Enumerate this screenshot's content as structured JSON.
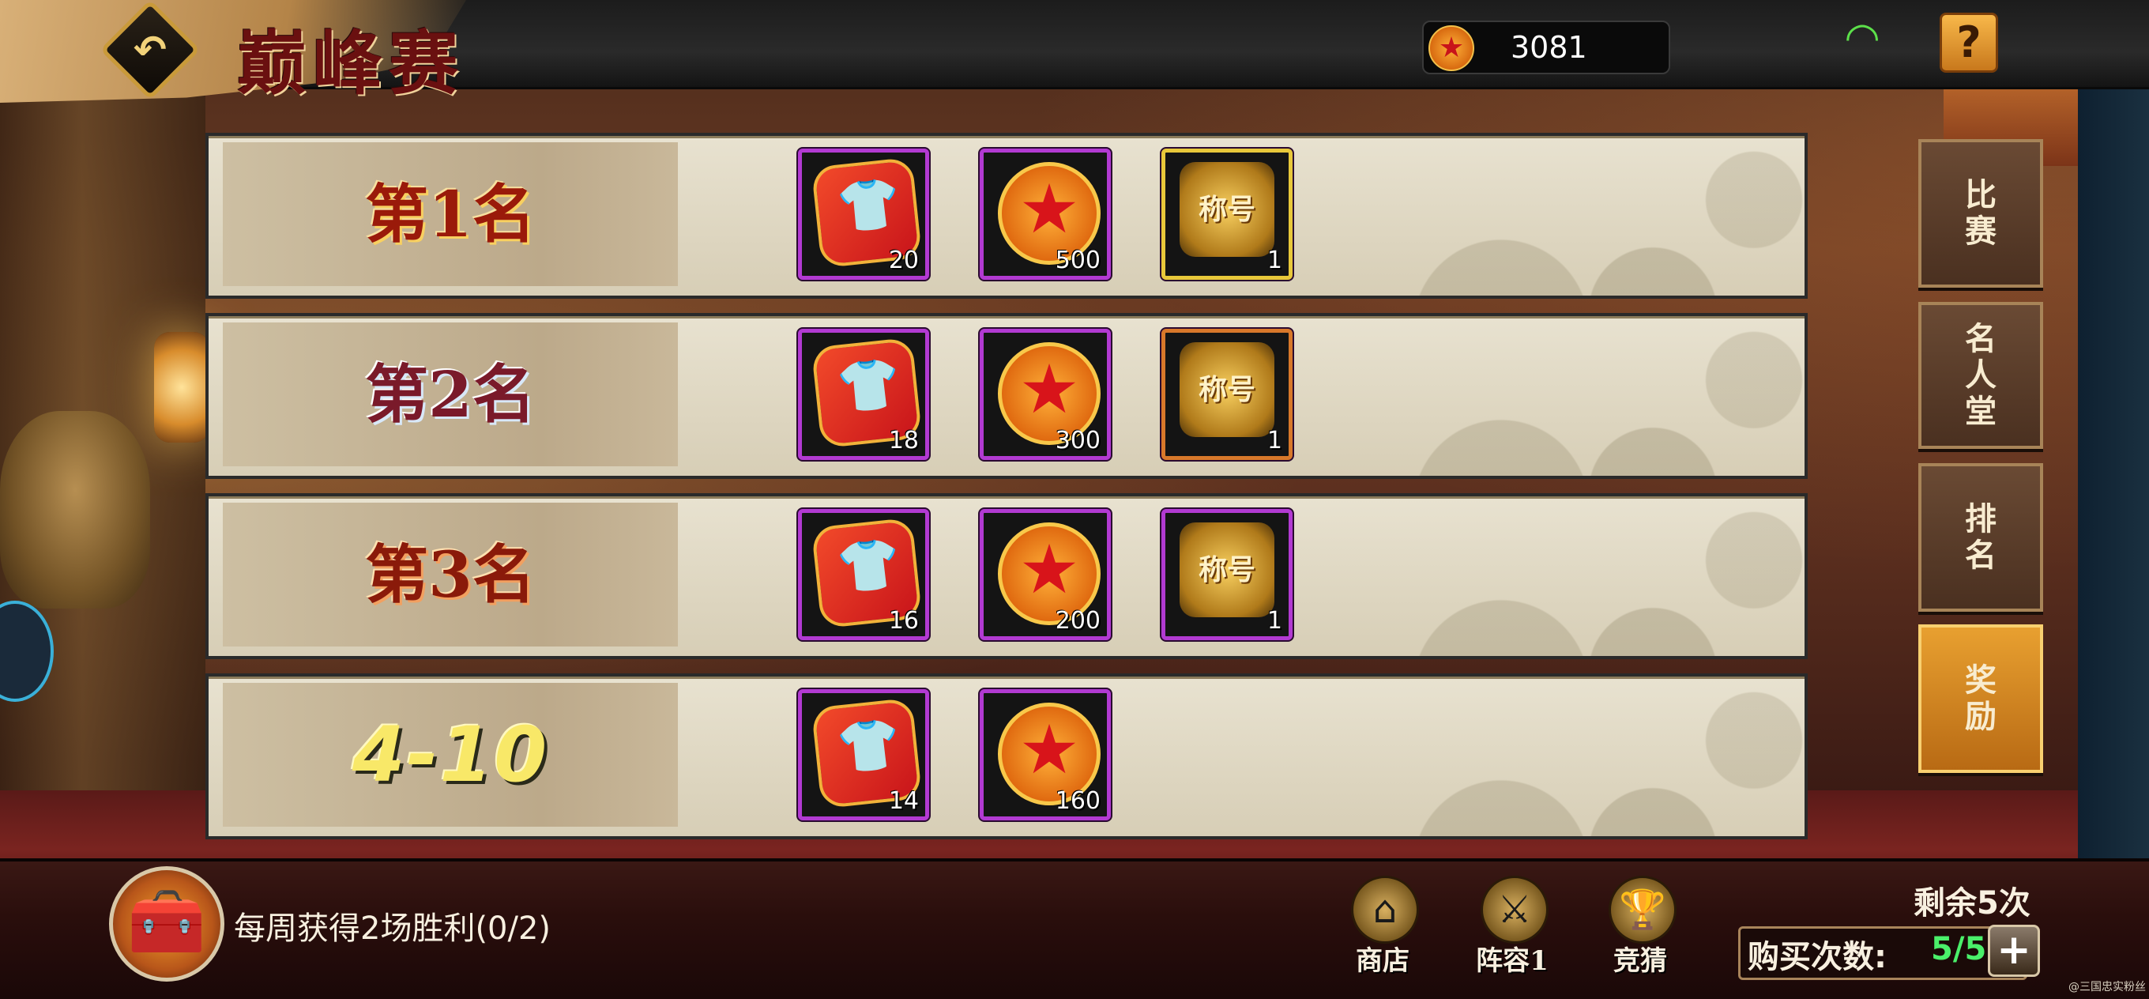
{
  "header": {
    "title": "巅峰赛",
    "currency_amount": "3081",
    "back_icon": "back-arrow-icon",
    "wifi_icon": "wifi-icon",
    "help_label": "?"
  },
  "rewards": [
    {
      "rank_label": "第1名",
      "items": [
        {
          "icon": "clothing-fragment-icon",
          "count": "20",
          "frame": "purple"
        },
        {
          "icon": "gold-coin-icon",
          "count": "500",
          "frame": "purple"
        },
        {
          "icon": "title-medal-icon",
          "label": "称号",
          "count": "1",
          "frame": "gold"
        }
      ]
    },
    {
      "rank_label": "第2名",
      "items": [
        {
          "icon": "clothing-fragment-icon",
          "count": "18",
          "frame": "purple"
        },
        {
          "icon": "gold-coin-icon",
          "count": "300",
          "frame": "purple"
        },
        {
          "icon": "title-medal-icon",
          "label": "称号",
          "count": "1",
          "frame": "orange"
        }
      ]
    },
    {
      "rank_label": "第3名",
      "items": [
        {
          "icon": "clothing-fragment-icon",
          "count": "16",
          "frame": "purple"
        },
        {
          "icon": "gold-coin-icon",
          "count": "200",
          "frame": "purple"
        },
        {
          "icon": "title-medal-icon",
          "label": "称号",
          "count": "1",
          "frame": "purple"
        }
      ]
    },
    {
      "rank_label": "4-10",
      "items": [
        {
          "icon": "clothing-fragment-icon",
          "count": "14",
          "frame": "purple"
        },
        {
          "icon": "gold-coin-icon",
          "count": "160",
          "frame": "purple"
        }
      ]
    }
  ],
  "tabs": [
    {
      "label": "比赛",
      "active": false
    },
    {
      "label": "名人堂",
      "active": false
    },
    {
      "label": "排名",
      "active": false
    },
    {
      "label": "奖励",
      "active": true
    }
  ],
  "footer": {
    "weekly_task": "每周获得2场胜利(0/2)",
    "buttons": [
      {
        "label": "商店",
        "icon": "shop-icon"
      },
      {
        "label": "阵容1",
        "icon": "crossed-swords-icon"
      },
      {
        "label": "竞猜",
        "icon": "trophy-icon"
      }
    ],
    "remaining": "剩余5次",
    "buy_label": "购买次数:",
    "buy_count": "5/5",
    "plus_label": "+"
  },
  "watermark": "@三国忠实粉丝",
  "colors": {
    "frame_purple": "#b23ad2",
    "frame_gold": "#e8c83a",
    "frame_orange": "#d8782a",
    "tab_active": "#e8a030",
    "buy_count": "#4af06a"
  }
}
